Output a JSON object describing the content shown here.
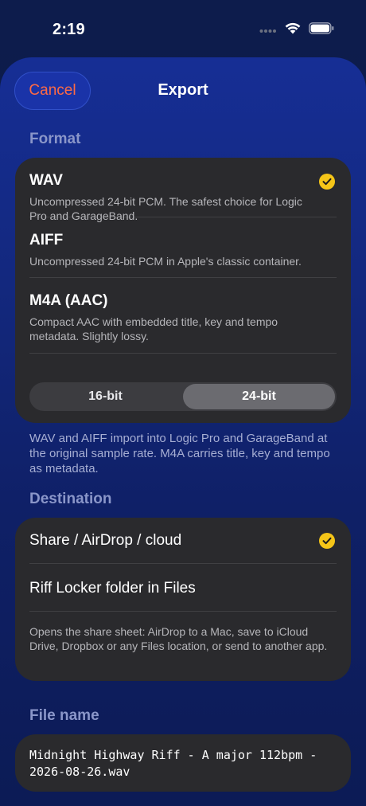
{
  "status_bar": {
    "time": "2:19",
    "icons": [
      "signal-dots-icon",
      "wifi-icon",
      "battery-icon"
    ]
  },
  "nav": {
    "cancel_label": "Cancel",
    "title": "Export"
  },
  "format": {
    "header": "Format",
    "options": [
      {
        "title": "WAV",
        "subtitle": "Uncompressed 24-bit PCM. The safest choice for Logic Pro and GarageBand.",
        "selected": true
      },
      {
        "title": "AIFF",
        "subtitle": "Uncompressed 24-bit PCM in Apple's classic container.",
        "selected": false
      },
      {
        "title": "M4A (AAC)",
        "subtitle": "Compact AAC with embedded title, key and tempo metadata. Slightly lossy.",
        "selected": false
      }
    ],
    "bit_depth": {
      "options": [
        "16-bit",
        "24-bit"
      ],
      "selected": "24-bit"
    },
    "footnote": "WAV and AIFF import into Logic Pro and GarageBand at the original sample rate. M4A carries title, key and tempo as metadata."
  },
  "destination": {
    "header": "Destination",
    "options": [
      {
        "title": "Share / AirDrop / cloud",
        "selected": true
      },
      {
        "title": "Riff Locker folder in Files",
        "selected": false
      }
    ],
    "description": "Opens the share sheet: AirDrop to a Mac, save to iCloud Drive, Dropbox or any Files location, or send to another app."
  },
  "file_name": {
    "header": "File name",
    "value": "Midnight Highway Riff - A major 112bpm - 2026-08-26.wav"
  },
  "colors": {
    "accent_check": "#f5c518",
    "cancel_text": "#ff6a45",
    "card_bg": "#2a2a2d",
    "section_header": "#8a96c9"
  }
}
